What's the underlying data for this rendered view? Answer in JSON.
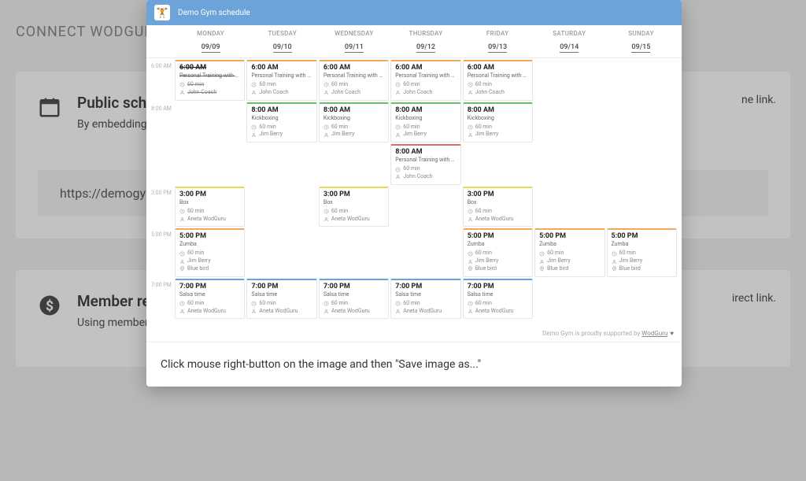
{
  "background": {
    "page_title": "CONNECT WODGUR",
    "section1": {
      "heading": "Public schedu",
      "sub": "By embedding the",
      "sub_tail": "ne link.",
      "link": "https://demogym.w"
    },
    "section2": {
      "heading": "Member regis",
      "sub": "Using member re",
      "sub_tail": "irect link."
    }
  },
  "modal": {
    "title": "Demo Gym schedule",
    "footer_pre": "Demo Gym is proudly supported by ",
    "footer_link": "WodGuru",
    "instruction": "Click mouse right-button on the image and then \"Save image as...\""
  },
  "days": [
    {
      "name": "MONDAY",
      "date": "09/09"
    },
    {
      "name": "TUESDAY",
      "date": "09/10"
    },
    {
      "name": "WEDNESDAY",
      "date": "09/11"
    },
    {
      "name": "THURSDAY",
      "date": "09/12"
    },
    {
      "name": "FRIDAY",
      "date": "09/13"
    },
    {
      "name": "SATURDAY",
      "date": "09/14"
    },
    {
      "name": "SUNDAY",
      "date": "09/15"
    }
  ],
  "row_labels": [
    "6:00 AM",
    "8:00 AM",
    "3:00 PM",
    "5:00 PM",
    "7:00 PM"
  ],
  "schedule": {
    "r0": [
      {
        "time": "6:00 AM",
        "title": "Personal Training with John",
        "dur": "60 min",
        "who": "John Coach",
        "col": "orange",
        "struck": true
      },
      {
        "time": "6:00 AM",
        "title": "Personal Training with John",
        "dur": "60 min",
        "who": "John Coach",
        "col": "orange"
      },
      {
        "time": "6:00 AM",
        "title": "Personal Training with John",
        "dur": "60 min",
        "who": "John Coach",
        "col": "orange"
      },
      {
        "time": "6:00 AM",
        "title": "Personal Training with John",
        "dur": "60 min",
        "who": "John Coach",
        "col": "orange"
      },
      {
        "time": "6:00 AM",
        "title": "Personal Training with John",
        "dur": "60 min",
        "who": "John Coach",
        "col": "orange"
      },
      null,
      null
    ],
    "r1": [
      null,
      {
        "time": "8:00 AM",
        "title": "Kickboxing",
        "dur": "60 min",
        "who": "Jim Berry",
        "col": "green"
      },
      {
        "time": "8:00 AM",
        "title": "Kickboxing",
        "dur": "60 min",
        "who": "Jim Berry",
        "col": "green"
      },
      [
        {
          "time": "8:00 AM",
          "title": "Kickboxing",
          "dur": "60 min",
          "who": "Jim Berry",
          "col": "green"
        },
        {
          "time": "8:00 AM",
          "title": "Personal Training with John",
          "dur": "60 min",
          "who": "John Coach",
          "col": "red"
        }
      ],
      {
        "time": "8:00 AM",
        "title": "Kickboxing",
        "dur": "60 min",
        "who": "Jim Berry",
        "col": "green"
      },
      null,
      null
    ],
    "r2": [
      {
        "time": "3:00 PM",
        "title": "Box",
        "dur": "60 min",
        "who": "Aneta WodGuru",
        "col": "yellow"
      },
      null,
      {
        "time": "3:00 PM",
        "title": "Box",
        "dur": "60 min",
        "who": "Aneta WodGuru",
        "col": "yellow"
      },
      null,
      {
        "time": "3:00 PM",
        "title": "Box",
        "dur": "60 min",
        "who": "Aneta WodGuru",
        "col": "yellow"
      },
      null,
      null
    ],
    "r3": [
      {
        "time": "5:00 PM",
        "title": "Zumba",
        "dur": "60 min",
        "who": "Jim Berry",
        "loc": "Blue bird",
        "col": "orange"
      },
      null,
      null,
      null,
      {
        "time": "5:00 PM",
        "title": "Zumba",
        "dur": "60 min",
        "who": "Jim Berry",
        "loc": "Blue bird",
        "col": "orange"
      },
      {
        "time": "5:00 PM",
        "title": "Zumba",
        "dur": "60 min",
        "who": "Jim Berry",
        "loc": "Blue bird",
        "col": "orange"
      },
      {
        "time": "5:00 PM",
        "title": "Zumba",
        "dur": "60 min",
        "who": "Jim Berry",
        "loc": "Blue bird",
        "col": "orange"
      }
    ],
    "r4": [
      {
        "time": "7:00 PM",
        "title": "Salsa time",
        "dur": "60 min",
        "who": "Aneta WodGuru",
        "col": "blue"
      },
      {
        "time": "7:00 PM",
        "title": "Salsa time",
        "dur": "60 min",
        "who": "Aneta WodGuru",
        "col": "blue"
      },
      {
        "time": "7:00 PM",
        "title": "Salsa time",
        "dur": "60 min",
        "who": "Aneta WodGuru",
        "col": "blue"
      },
      {
        "time": "7:00 PM",
        "title": "Salsa time",
        "dur": "60 min",
        "who": "Aneta WodGuru",
        "col": "blue"
      },
      {
        "time": "7:00 PM",
        "title": "Salsa time",
        "dur": "60 min",
        "who": "Aneta WodGuru",
        "col": "blue"
      },
      null,
      null
    ]
  }
}
